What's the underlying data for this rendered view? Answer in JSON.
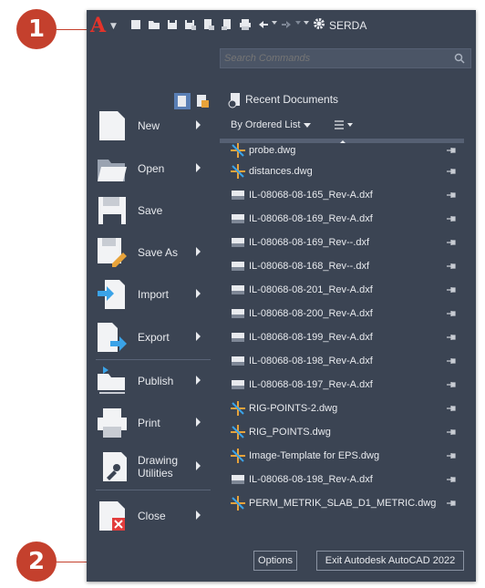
{
  "callouts": [
    {
      "label": "1"
    },
    {
      "label": "2"
    }
  ],
  "app_button": {
    "label": "A",
    "icon": "autocad-logo-icon",
    "color": "#e5332a"
  },
  "quick_access_toolbar": {
    "icons": [
      "new-icon",
      "open-icon",
      "save-icon",
      "save-as-icon",
      "plot-preview-icon",
      "publish-icon",
      "print-icon",
      "undo-icon",
      "redo-icon",
      "gear-icon"
    ],
    "workspace_label": "SERDA"
  },
  "search": {
    "placeholder": "Search Commands",
    "icon": "search-icon"
  },
  "menu": {
    "items": [
      {
        "label": "New",
        "icon": "new-document-icon",
        "has_submenu": true
      },
      {
        "label": "Open",
        "icon": "folder-open-icon",
        "has_submenu": true
      },
      {
        "label": "Save",
        "icon": "save-icon",
        "has_submenu": false
      },
      {
        "label": "Save As",
        "icon": "save-as-icon",
        "has_submenu": true
      },
      {
        "label": "Import",
        "icon": "import-icon",
        "has_submenu": true
      },
      {
        "label": "Export",
        "icon": "export-icon",
        "has_submenu": true
      },
      {
        "label": "Publish",
        "icon": "publish-icon",
        "has_submenu": true
      },
      {
        "label": "Print",
        "icon": "printer-icon",
        "has_submenu": true
      },
      {
        "label": "Drawing\nUtilities",
        "icon": "wrench-icon",
        "has_submenu": true
      },
      {
        "label": "Close",
        "icon": "close-document-icon",
        "has_submenu": true
      }
    ]
  },
  "recent": {
    "title": "Recent Documents",
    "sort_label": "By Ordered List",
    "files": [
      {
        "name": "probe.dwg",
        "type": "dwg"
      },
      {
        "name": "distances.dwg",
        "type": "dwg"
      },
      {
        "name": "IL-08068-08-165_Rev-A.dxf",
        "type": "dxf"
      },
      {
        "name": "IL-08068-08-169_Rev-A.dxf",
        "type": "dxf"
      },
      {
        "name": "IL-08068-08-169_Rev--.dxf",
        "type": "dxf"
      },
      {
        "name": "IL-08068-08-168_Rev--.dxf",
        "type": "dxf"
      },
      {
        "name": "IL-08068-08-201_Rev-A.dxf",
        "type": "dxf"
      },
      {
        "name": "IL-08068-08-200_Rev-A.dxf",
        "type": "dxf"
      },
      {
        "name": "IL-08068-08-199_Rev-A.dxf",
        "type": "dxf"
      },
      {
        "name": "IL-08068-08-198_Rev-A.dxf",
        "type": "dxf"
      },
      {
        "name": "IL-08068-08-197_Rev-A.dxf",
        "type": "dxf"
      },
      {
        "name": "RIG-POINTS-2.dwg",
        "type": "dwg"
      },
      {
        "name": "RIG_POINTS.dwg",
        "type": "dwg"
      },
      {
        "name": "Image-Template for EPS.dwg",
        "type": "dwg"
      },
      {
        "name": "IL-08068-08-198_Rev-A.dxf",
        "type": "dxf"
      },
      {
        "name": "PERM_METRIK_SLAB_D1_METRIC.dwg",
        "type": "dwg"
      }
    ]
  },
  "footer": {
    "options_label": "Options",
    "exit_label": "Exit Autodesk AutoCAD 2022"
  },
  "colors": {
    "callout": "#c4402d",
    "panel": "#3b4453",
    "text": "#e8eaee"
  }
}
